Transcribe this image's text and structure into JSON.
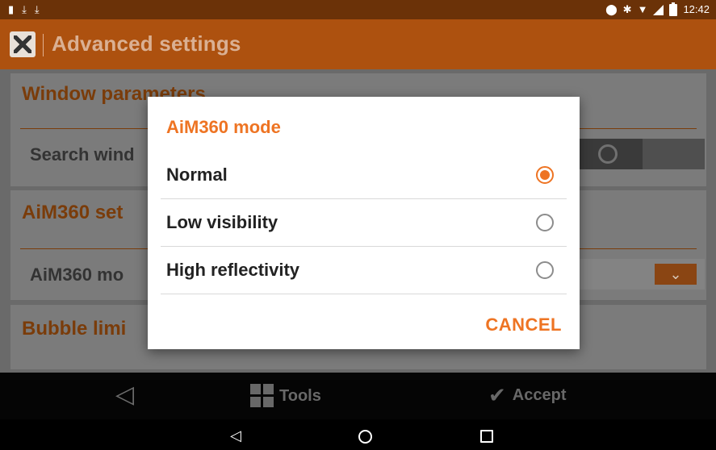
{
  "status_bar": {
    "left_icons": [
      "sim-icon",
      "download-icon",
      "download-icon"
    ],
    "right_icons": [
      "location-icon",
      "bluetooth-icon",
      "wifi-icon",
      "signal-icon",
      "battery-icon"
    ],
    "time": "12:42"
  },
  "app_bar": {
    "title": "Advanced settings",
    "logo_icon": "app-logo-icon"
  },
  "content": {
    "window_parameters": "Window parameters",
    "search_window": "Search wind",
    "aim360_settings": "AiM360 set",
    "aim360_mode_label": "AiM360 mo",
    "bubble_limits": "Bubble limi"
  },
  "dialog": {
    "title": "AiM360 mode",
    "options": [
      {
        "label": "Normal",
        "selected": true
      },
      {
        "label": "Low visibility",
        "selected": false
      },
      {
        "label": "High reflectivity",
        "selected": false
      }
    ],
    "cancel_label": "CANCEL",
    "accent_color": "#ee7423"
  },
  "bottom_bar": {
    "tools_label": "Tools",
    "accept_label": "Accept"
  },
  "nav_bar": {
    "icons": [
      "back-icon",
      "home-icon",
      "recents-icon"
    ]
  },
  "colors": {
    "brand_brown": "#ad510f",
    "status_bar": "#6b3208"
  }
}
